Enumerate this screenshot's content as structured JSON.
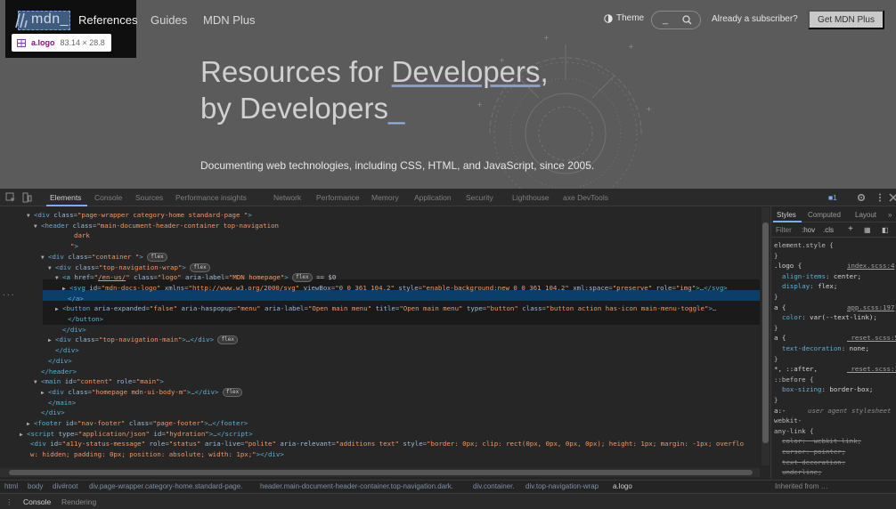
{
  "page": {
    "logo_text": "mdn_",
    "tooltip": {
      "tag": "a.logo",
      "dims": "83.14 × 28.8"
    },
    "nav": [
      "References",
      "Guides",
      "MDN Plus"
    ],
    "theme_label": "Theme",
    "search_placeholder": "_",
    "subscriber_text": "Already a subscriber?",
    "get_button": "Get MDN Plus",
    "hero_line1_pre": "Resources for ",
    "hero_line1_link": "Developers",
    "hero_line1_post": ",",
    "hero_line2": "by Developers",
    "hero_line2_cursor": "_",
    "lede": "Documenting web technologies, including CSS, HTML, and JavaScript, since 2005."
  },
  "devtools": {
    "tabs": [
      "Elements",
      "Console",
      "Sources",
      "Performance insights",
      "Network",
      "Performance",
      "Memory",
      "Application",
      "Security",
      "Lighthouse",
      "axe DevTools"
    ],
    "issues_count": "1",
    "style_tabs": [
      "Styles",
      "Computed",
      "Layout"
    ],
    "filter_placeholder": "Filter",
    "hov": ":hov",
    "cls": ".cls",
    "styles": [
      {
        "text": "element.style {"
      },
      {
        "text": "}"
      },
      {
        "sel": ".logo {",
        "src": "index.scss:4"
      },
      {
        "prop": "align-items",
        "val": "center;"
      },
      {
        "prop": "display",
        "val": "flex;"
      },
      {
        "text": "}"
      },
      {
        "sel": "a {",
        "src": "app.scss:197"
      },
      {
        "prop": "color",
        "val": "var(--text-link);"
      },
      {
        "text": "}"
      },
      {
        "sel": "a {",
        "src": "_reset.scss:55"
      },
      {
        "prop": "text-decoration",
        "val": "none;"
      },
      {
        "text": "}"
      },
      {
        "sel": "*, ::after,",
        "src": "_reset.scss:12"
      },
      {
        "text": "::before {"
      },
      {
        "prop": "box-sizing",
        "val": "border-box;"
      },
      {
        "text": "}"
      },
      {
        "sel": "a:-",
        "ua": "user agent stylesheet"
      },
      {
        "text": "webkit-"
      },
      {
        "text": "any-link {"
      },
      {
        "struck": "color: -webkit-link;"
      },
      {
        "struck": "cursor: pointer;"
      },
      {
        "struck": "text-decoration:"
      },
      {
        "struck": "underline;"
      }
    ],
    "dom_lines": [
      {
        "indent": 30,
        "arrow": "▼",
        "html": "<span class='tg'>&lt;div</span> <span class='an'>class</span>=<span class='av'>\"page-wrapper  category-home standard-page \"</span><span class='tg'>&gt;</span>"
      },
      {
        "indent": 38,
        "arrow": "▼",
        "html": "<span class='tg'>&lt;header</span> <span class='an'>class</span>=<span class='av'>\"main-document-header-container top-navigation</span>"
      },
      {
        "indent": 75,
        "arrow": "",
        "html": "<span class='av'>dark</span>"
      },
      {
        "indent": 71,
        "arrow": "",
        "html": "<span class='av'>\"</span><span class='tg'>&gt;</span>"
      },
      {
        "indent": 46,
        "arrow": "▼",
        "html": "<span class='tg'>&lt;div</span> <span class='an'>class</span>=<span class='av'>\"container \"</span><span class='tg'>&gt;</span> <span class='badge'>flex</span>"
      },
      {
        "indent": 54,
        "arrow": "▼",
        "html": "<span class='tg'>&lt;div</span> <span class='an'>class</span>=<span class='av'>\"top-navigation-wrap\"</span><span class='tg'>&gt;</span> <span class='badge'>flex</span>"
      },
      {
        "indent": 62,
        "arrow": "▼",
        "html": "<span class='tg'>&lt;a</span> <span class='an'>href</span>=<span class='av'>\"<u>/en-us/</u>\"</span> <span class='an'>class</span>=<span class='av'>\"logo\"</span> <span class='an'>aria-label</span>=<span class='av'>\"MDN homepage\"</span><span class='tg'>&gt;</span> <span class='badge'>flex</span> <span class='tx'>== $0</span>"
      },
      {
        "indent": 70,
        "arrow": "▶",
        "html": "<span class='tg'>&lt;svg</span> <span class='an'>id</span>=<span class='av'>\"mdn-docs-logo\"</span> <span class='an'>xmlns</span>=<span class='av'>\"http://www.w3.org/2000/svg\"</span> <span class='an'>viewBox</span>=<span class='av'>\"0 0 361 104.2\"</span> <span class='an'>style</span>=<span class='av'>\"enable-background:new 0 0 361 104.2\"</span> <span class='an'>xml:space</span>=<span class='av'>\"preserve\"</span> <span class='an'>role</span>=<span class='av'>\"img\"</span><span class='tg'>&gt;</span>…<span class='tg'>&lt;/svg&gt;</span>"
      },
      {
        "indent": 68,
        "arrow": "",
        "html": "<span class='tg'>&lt;/a&gt;</span>"
      },
      {
        "indent": 62,
        "arrow": "▶",
        "html": "<span class='tg'>&lt;button</span> <span class='an'>aria-expanded</span>=<span class='av'>\"false\"</span> <span class='an'>aria-haspopup</span>=<span class='av'>\"menu\"</span> <span class='an'>aria-label</span>=<span class='av'>\"Open main menu\"</span> <span class='an'>title</span>=<span class='av'>\"Open main menu\"</span> <span class='an'>type</span>=<span class='av'>\"button\"</span> <span class='an'>class</span>=<span class='av'>\"button action has-icon main-menu-toggle\"</span><span class='tg'>&gt;</span>…"
      },
      {
        "indent": 68,
        "arrow": "",
        "html": "<span class='tg'>&lt;/button&gt;</span>"
      },
      {
        "indent": 62,
        "arrow": "",
        "html": "<span class='tg'>&lt;/div&gt;</span>"
      },
      {
        "indent": 54,
        "arrow": "▶",
        "html": "<span class='tg'>&lt;div</span> <span class='an'>class</span>=<span class='av'>\"top-navigation-main\"</span><span class='tg'>&gt;</span>…<span class='tg'>&lt;/div&gt;</span> <span class='badge'>flex</span>"
      },
      {
        "indent": 54,
        "arrow": "",
        "html": "<span class='tg'>&lt;/div&gt;</span>"
      },
      {
        "indent": 46,
        "arrow": "",
        "html": "<span class='tg'>&lt;/div&gt;</span>"
      },
      {
        "indent": 38,
        "arrow": "",
        "html": "<span class='tg'>&lt;/header&gt;</span>"
      },
      {
        "indent": 38,
        "arrow": "▼",
        "html": "<span class='tg'>&lt;main</span> <span class='an'>id</span>=<span class='av'>\"content\"</span> <span class='an'>role</span>=<span class='av'>\"main\"</span><span class='tg'>&gt;</span>"
      },
      {
        "indent": 46,
        "arrow": "▶",
        "html": "<span class='tg'>&lt;div</span> <span class='an'>class</span>=<span class='av'>\"homepage mdn-ui-body-m\"</span><span class='tg'>&gt;</span>…<span class='tg'>&lt;/div&gt;</span> <span class='badge'>flex</span>"
      },
      {
        "indent": 46,
        "arrow": "",
        "html": "<span class='tg'>&lt;/main&gt;</span>"
      },
      {
        "indent": 38,
        "arrow": "",
        "html": "<span class='tg'>&lt;/div&gt;</span>"
      },
      {
        "indent": 30,
        "arrow": "▶",
        "html": "<span class='tg'>&lt;footer</span> <span class='an'>id</span>=<span class='av'>\"nav-footer\"</span> <span class='an'>class</span>=<span class='av'>\"page-footer\"</span><span class='tg'>&gt;</span>…<span class='tg'>&lt;/footer&gt;</span>"
      },
      {
        "indent": 22,
        "arrow": "▶",
        "html": "<span class='tg'>&lt;script</span> <span class='an'>type</span>=<span class='av'>\"application/json\"</span> <span class='an'>id</span>=<span class='av'>\"hydration\"</span><span class='tg'>&gt;</span>…<span class='tg'>&lt;/script&gt;</span>"
      },
      {
        "indent": 26,
        "arrow": "",
        "html": "<span class='tg'>&lt;div</span> <span class='an'>id</span>=<span class='av'>\"a11y-status-message\"</span> <span class='an'>role</span>=<span class='av'>\"status\"</span> <span class='an'>aria-live</span>=<span class='av'>\"polite\"</span> <span class='an'>aria-relevant</span>=<span class='av'>\"additions text\"</span> <span class='an'>style</span>=<span class='av'>\"border: 0px; clip: rect(0px, 0px, 0px, 0px); height: 1px; margin: -1px; overflo</span>"
      },
      {
        "indent": 26,
        "arrow": "",
        "html": "<span class='av'>w: hidden; padding: 0px; position: absolute; width: 1px;\"</span><span class='tg'>&gt;&lt;/div&gt;</span>"
      }
    ],
    "breadcrumbs": [
      "html",
      "body",
      "div#root",
      "div.page-wrapper.category-home.standard-page.",
      "header.main-document-header-container.top-navigation.dark.",
      "div.container.",
      "div.top-navigation-wrap",
      "a.logo"
    ],
    "inherited_from": "Inherited from …",
    "drawer_tabs": [
      "Console",
      "Rendering"
    ]
  }
}
